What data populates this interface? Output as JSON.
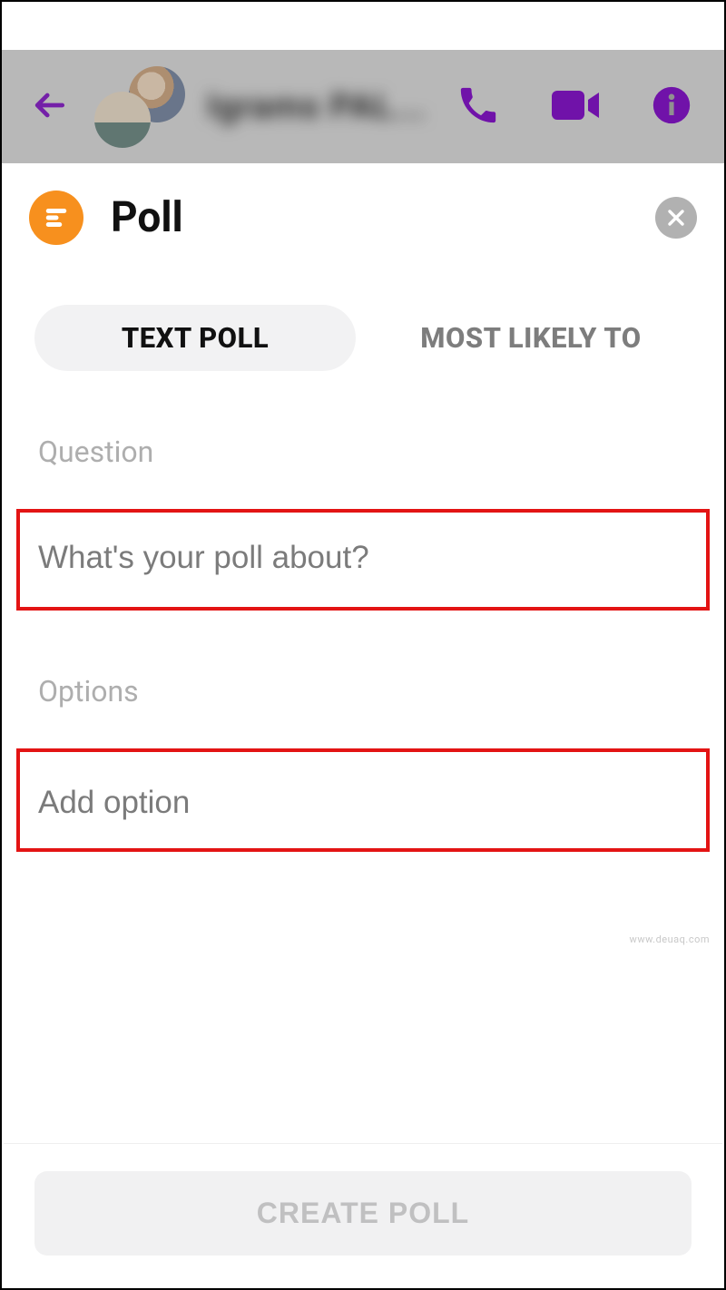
{
  "nav": {
    "chat_name": "Igrams PAL..."
  },
  "sheet": {
    "title": "Poll",
    "tabs": {
      "text_poll": "TEXT POLL",
      "most_likely": "MOST LIKELY TO"
    },
    "question_label": "Question",
    "question_placeholder": "What's your poll about?",
    "options_label": "Options",
    "option_placeholder": "Add option",
    "create_button": "CREATE POLL"
  },
  "watermark": "www.deuaq.com"
}
